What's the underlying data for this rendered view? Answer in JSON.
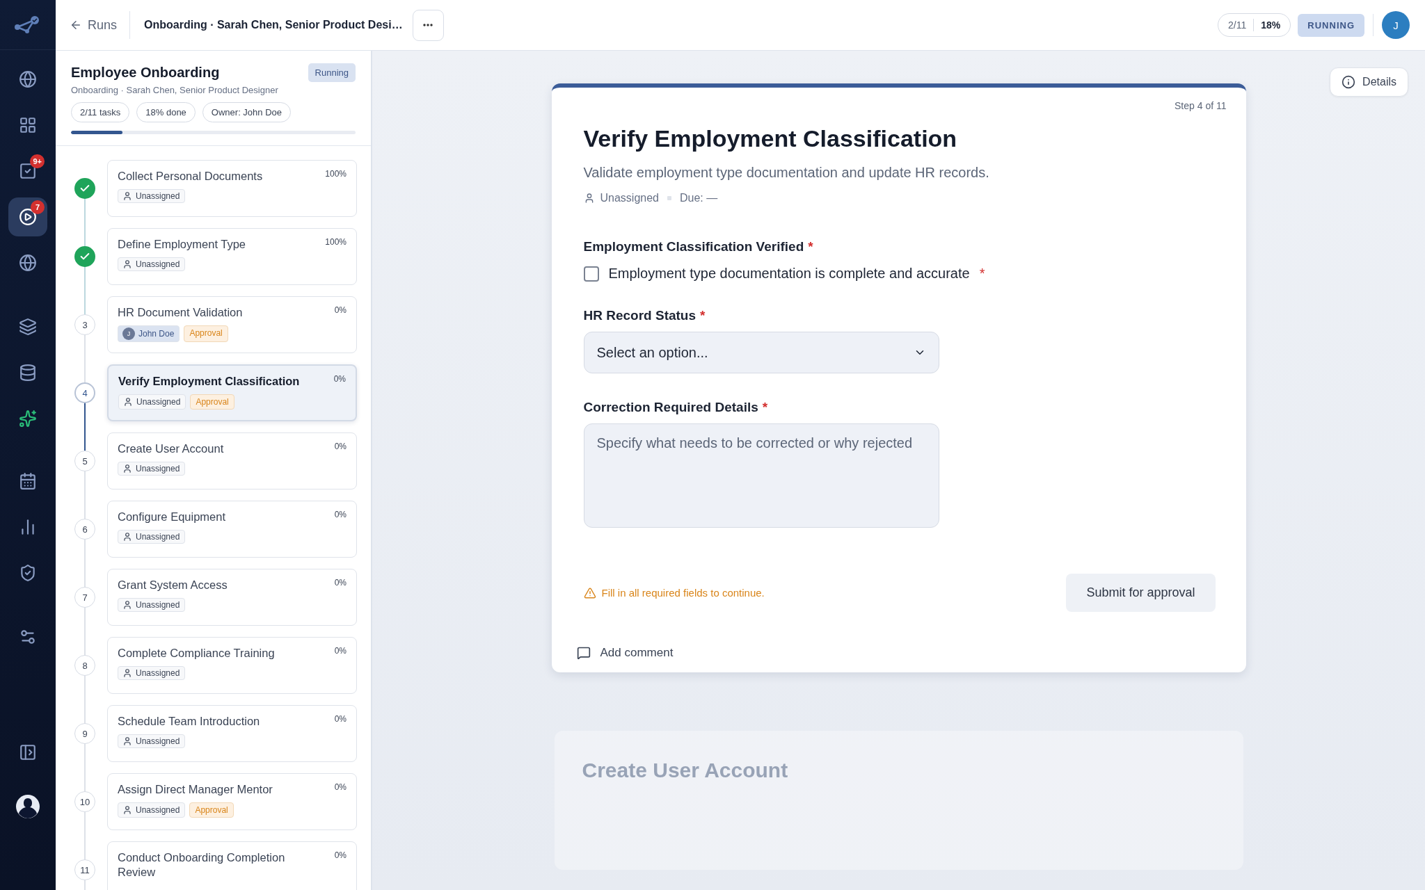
{
  "sidebar": {
    "items": [
      {
        "selected": false
      },
      {
        "selected": false
      },
      {
        "selected": false,
        "badge": "9+"
      },
      {
        "selected": true,
        "badge": "7"
      },
      {
        "selected": false
      },
      {
        "selected": false
      },
      {
        "selected": false
      },
      {
        "selected": false
      },
      {
        "selected": false
      },
      {
        "selected": false
      },
      {
        "selected": false
      },
      {
        "selected": false
      },
      {
        "selected": false
      },
      {
        "selected": false
      }
    ]
  },
  "top_bar": {
    "back": "Runs",
    "title": "Onboarding · Sarah Chen, Senior Product Desi…",
    "progress_count": "2/11",
    "progress_percent": "18%",
    "status": "RUNNING",
    "avatar": "J"
  },
  "run": {
    "title": "Employee Onboarding",
    "status": "Running",
    "subtitle": "Onboarding · Sarah Chen, Senior Product Designer",
    "chips": [
      "2/11 tasks",
      "18% done",
      "Owner: John Doe"
    ],
    "level": 0.18
  },
  "tasks": [
    {
      "completed": true,
      "title": "Collect Personal Documents",
      "percent": "100%",
      "assignee": {
        "kind": "none",
        "name": "Unassigned"
      },
      "selected": false
    },
    {
      "completed": true,
      "title": "Define Employment Type",
      "percent": "100%",
      "assignee": {
        "kind": "none",
        "name": "Unassigned"
      },
      "selected": false
    },
    {
      "completed": false,
      "number": "3",
      "title": "HR Document Validation",
      "percent": "0%",
      "assignee": {
        "kind": "user",
        "name": "John Doe",
        "initial": "J"
      },
      "tag": "Approval",
      "selected": false
    },
    {
      "completed": false,
      "number": "4",
      "title": "Verify Employment Classification",
      "percent": "0%",
      "assignee": {
        "kind": "none",
        "name": "Unassigned"
      },
      "tag": "Approval",
      "selected": true
    },
    {
      "completed": false,
      "number": "5",
      "title": "Create User Account",
      "percent": "0%",
      "assignee": {
        "kind": "none",
        "name": "Unassigned"
      },
      "selected": false
    },
    {
      "completed": false,
      "number": "6",
      "title": "Configure Equipment",
      "percent": "0%",
      "assignee": {
        "kind": "none",
        "name": "Unassigned"
      },
      "selected": false
    },
    {
      "completed": false,
      "number": "7",
      "title": "Grant System Access",
      "percent": "0%",
      "assignee": {
        "kind": "none",
        "name": "Unassigned"
      },
      "selected": false
    },
    {
      "completed": false,
      "number": "8",
      "title": "Complete Compliance Training",
      "percent": "0%",
      "assignee": {
        "kind": "none",
        "name": "Unassigned"
      },
      "selected": false
    },
    {
      "completed": false,
      "number": "9",
      "title": "Schedule Team Introduction",
      "percent": "0%",
      "assignee": {
        "kind": "none",
        "name": "Unassigned"
      },
      "selected": false
    },
    {
      "completed": false,
      "number": "10",
      "title": "Assign Direct Manager Mentor",
      "percent": "0%",
      "assignee": {
        "kind": "none",
        "name": "Unassigned"
      },
      "tag": "Approval",
      "selected": false
    },
    {
      "completed": false,
      "number": "11",
      "title": "Conduct Onboarding Completion Review",
      "percent": "0%",
      "selected": false
    }
  ],
  "details_button": "Details",
  "step": {
    "counter": "Step 4 of 11",
    "title": "Verify Employment Classification",
    "description": "Validate employment type documentation and update HR records.",
    "assignee": "Unassigned",
    "due": "Due: —",
    "fields": [
      {
        "kind": "checkbox",
        "label": "Employment Classification Verified",
        "required_mark": "*",
        "option": "Employment type documentation is complete and accurate",
        "option_mark": "*",
        "checked": false
      },
      {
        "kind": "select",
        "label": "HR Record Status",
        "required_mark": "*",
        "placeholder": "Select an option..."
      },
      {
        "kind": "textarea",
        "label": "Correction Required Details",
        "required_mark": "*",
        "placeholder": "Specify what needs to be corrected or why rejected"
      }
    ],
    "warning": "Fill in all required fields to continue.",
    "submit": "Submit for approval",
    "comment": "Add comment"
  },
  "next_step_preview": {
    "title": "Create User Account"
  }
}
